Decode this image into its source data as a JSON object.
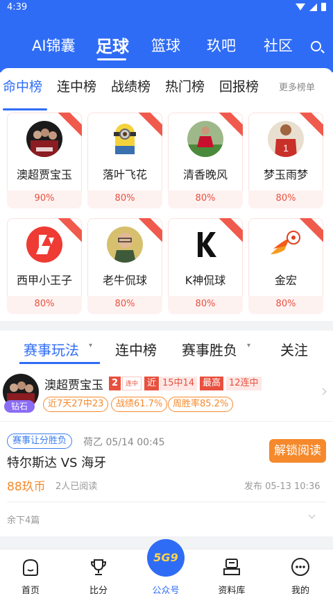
{
  "status": {
    "time": "4:39"
  },
  "topnav": {
    "items": [
      "AI锦囊",
      "足球",
      "篮球",
      "玖吧",
      "社区"
    ],
    "active": "足球"
  },
  "ranktabs": {
    "items": [
      "命中榜",
      "连中榜",
      "战绩榜",
      "热门榜",
      "回报榜"
    ],
    "more": "更多榜单"
  },
  "experts": [
    {
      "name": "澳超贾宝玉",
      "rate": "90%"
    },
    {
      "name": "落叶飞花",
      "rate": "80%"
    },
    {
      "name": "清香晚风",
      "rate": "80%"
    },
    {
      "name": "梦玉雨梦",
      "rate": "80%"
    },
    {
      "name": "西甲小王子",
      "rate": "80%"
    },
    {
      "name": "老牛侃球",
      "rate": "80%"
    },
    {
      "name": "K神侃球",
      "rate": "80%"
    },
    {
      "name": "金宏",
      "rate": "80%"
    }
  ],
  "tabs2": [
    "赛事玩法",
    "连中榜",
    "赛事胜负",
    "关注"
  ],
  "post": {
    "expert_name": "澳超贾宝玉",
    "level": "钻石",
    "streak_num": "2",
    "streak_label": "连中",
    "recent_label": "近",
    "recent_value": "15中14",
    "best_label": "最高",
    "best_value": "12连中",
    "chips": [
      "近7天27中23",
      "战绩61.7%",
      "周胜率85.2%"
    ],
    "match_tag": "赛事让分胜负",
    "league_time": "荷乙 05/14 00:45",
    "match": "特尔斯达 VS 海牙",
    "unlock": "解锁阅读",
    "price": "88玖币",
    "reads": "2人已阅读",
    "publish": "发布 05-13 10:36",
    "remaining": "余下4篇"
  },
  "botnav": [
    "首页",
    "比分",
    "公众号",
    "资料库",
    "我的"
  ],
  "center_logo": "5G9"
}
